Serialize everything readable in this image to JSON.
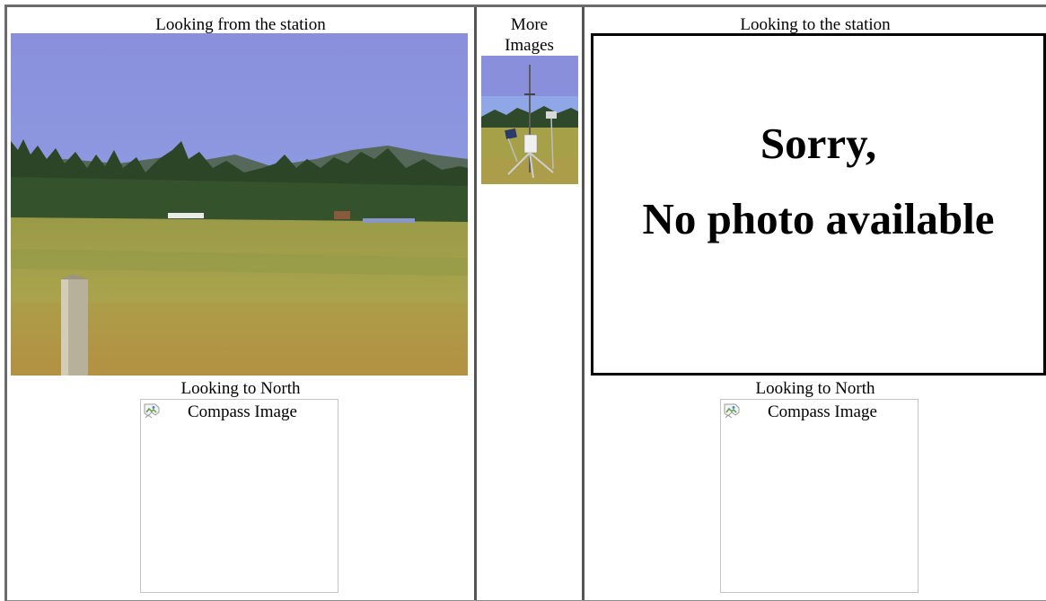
{
  "left_panel": {
    "caption": "Looking from the station",
    "photo_icon": "landscape-photo",
    "north_caption": "Looking to North",
    "compass_alt": "Compass Image"
  },
  "middle_panel": {
    "caption_line1": "More",
    "caption_line2": "Images",
    "thumb_icon": "weather-station-thumbnail"
  },
  "right_panel": {
    "caption": "Looking to the station",
    "no_photo_line1": "Sorry,",
    "no_photo_line2": "No photo available",
    "north_caption": "Looking to North",
    "compass_alt": "Compass Image"
  },
  "colors": {
    "frame_border": "#6b6b6b",
    "divider": "#555555",
    "compass_border": "#c4c4c4",
    "sky": "#7f8fd8",
    "grass": "#a7a046",
    "trees": "#2b4a26"
  }
}
